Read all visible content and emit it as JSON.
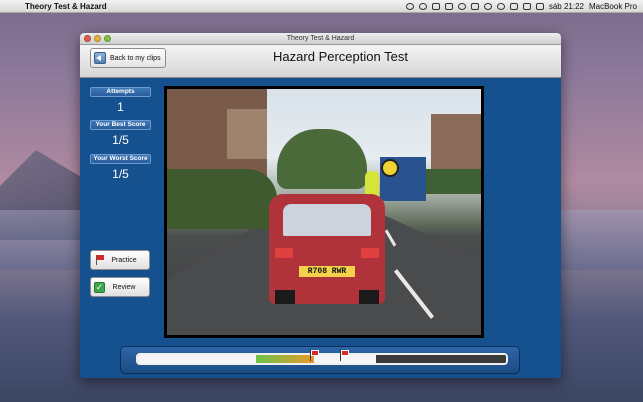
{
  "menubar": {
    "app_name": "Theory Test & Hazard",
    "time": "sáb 21:22",
    "device": "MacBook Pro"
  },
  "window": {
    "title": "Theory Test & Hazard"
  },
  "header": {
    "back_label": "Back to my clips",
    "page_title": "Hazard Perception Test"
  },
  "stats": {
    "attempts_label": "Attempts",
    "attempts_value": "1",
    "best_label": "Your Best Score",
    "best_value": "1/5",
    "worst_label": "Your Worst Score",
    "worst_value": "1/5"
  },
  "actions": {
    "practice_label": "Practice",
    "review_label": "Review"
  },
  "video": {
    "plate": "R708 RWR"
  },
  "timeline": {
    "colors": {
      "track": "#3a3a3a",
      "played": "#f5f5f5",
      "green": "#6cc24a",
      "orange": "#e89a2a",
      "flag": "#d62828"
    }
  }
}
